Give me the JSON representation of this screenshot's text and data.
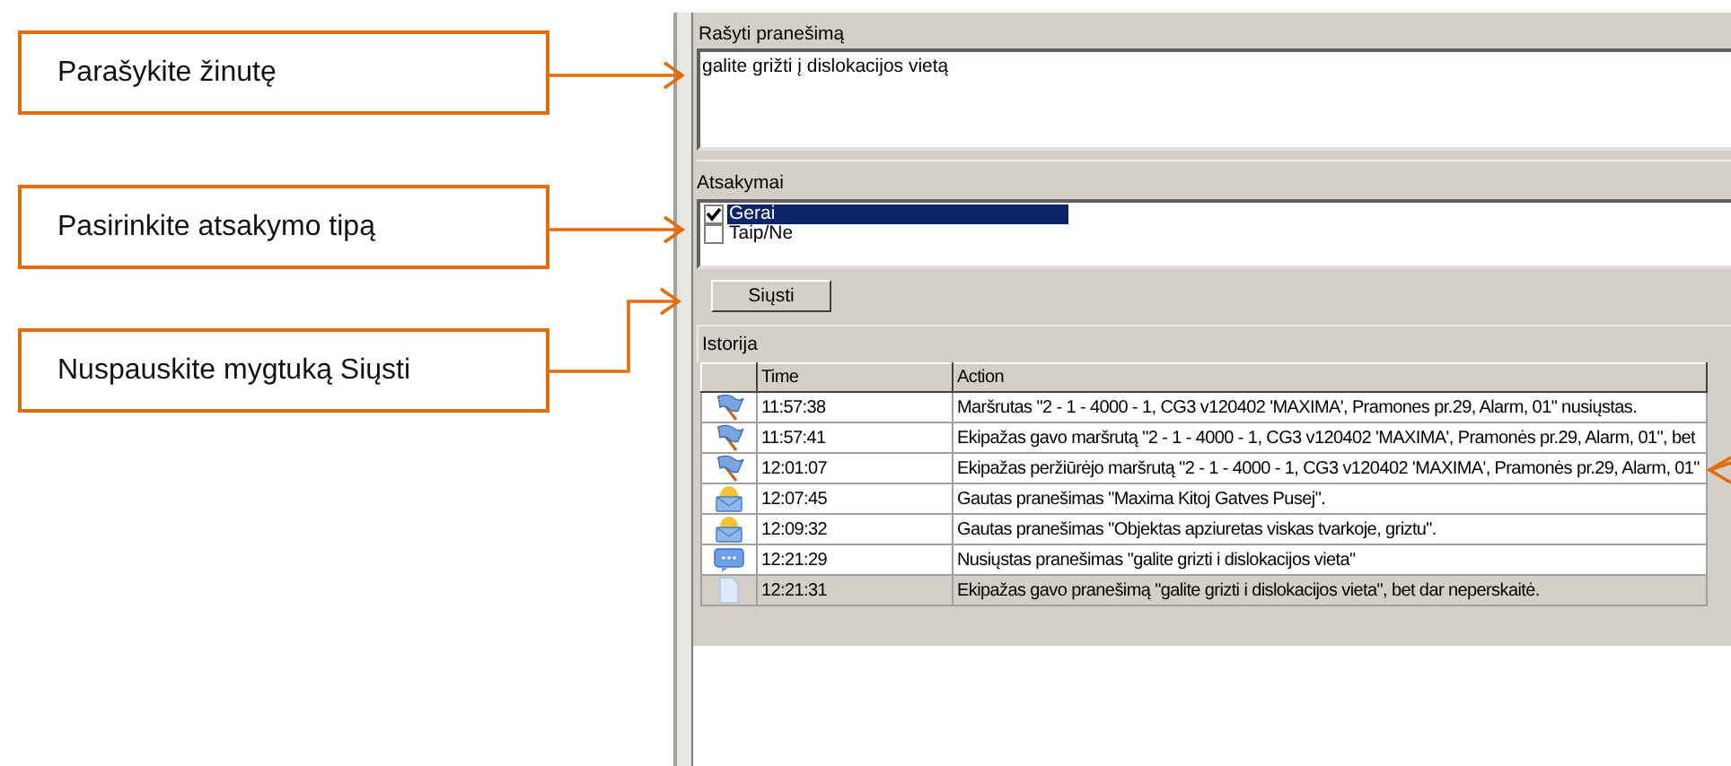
{
  "callouts": [
    {
      "text": "Parašykite žinutę"
    },
    {
      "text": "Pasirinkite atsakymo tipą"
    },
    {
      "text": "Nuspauskite mygtuką Siųsti"
    }
  ],
  "message": {
    "label": "Rašyti pranešimą",
    "value": "galite grižti į dislokacijos vietą"
  },
  "answers": {
    "label": "Atsakymai",
    "items": [
      {
        "label": "Gerai",
        "checked": true,
        "selected": true
      },
      {
        "label": "Taip/Ne",
        "checked": false,
        "selected": false
      }
    ]
  },
  "send_button": "Siųsti",
  "history": {
    "label": "Istorija",
    "columns": [
      "Time",
      "Action"
    ],
    "rows": [
      {
        "kind": "flag",
        "time": "11:57:38",
        "action": "Maršrutas \"2 - 1 - 4000 - 1, CG3 v120402 'MAXIMA', Pramones pr.29, Alarm, 01\" nusiųstas.",
        "selected": false
      },
      {
        "kind": "flag",
        "time": "11:57:41",
        "action": "Ekipažas gavo maršrutą \"2 - 1 - 4000 - 1, CG3 v120402 'MAXIMA', Pramonės pr.29, Alarm, 01\", bet",
        "selected": false
      },
      {
        "kind": "flag",
        "time": "12:01:07",
        "action": "Ekipažas peržiūrėjo maršrutą \"2 - 1 - 4000 - 1, CG3 v120402 'MAXIMA', Pramonės pr.29, Alarm, 01\"",
        "selected": false
      },
      {
        "kind": "envelope",
        "time": "12:07:45",
        "action": "Gautas pranešimas \"Maxima Kitoj Gatves Pusej\".",
        "selected": false
      },
      {
        "kind": "envelope",
        "time": "12:09:32",
        "action": "Gautas pranešimas \"Objektas apziuretas viskas tvarkoje, griztu\".",
        "selected": false
      },
      {
        "kind": "chat",
        "time": "12:21:29",
        "action": "Nusiųstas pranešimas \"galite grizti i dislokacijos vieta\"",
        "selected": false
      },
      {
        "kind": "document",
        "time": "12:21:31",
        "action": "Ekipažas gavo pranešimą \"galite grizti i dislokacijos vieta\", bet dar neperskaitė.",
        "selected": true
      }
    ]
  }
}
